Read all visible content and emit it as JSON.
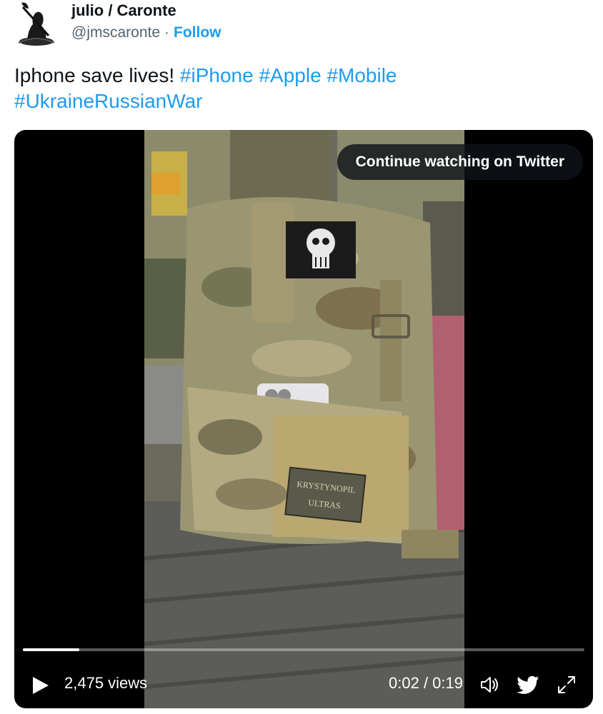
{
  "author": {
    "name": "julio / Caronte",
    "handle": "@jmscaronte",
    "separator": "·",
    "follow_label": "Follow",
    "avatar_icon": "caronte-avatar-icon"
  },
  "tweet": {
    "text": "Iphone save lives! ",
    "hashtags": [
      "#iPhone",
      "#Apple",
      "#Mobile",
      "#UkraineRussianWar"
    ]
  },
  "video": {
    "overlay_label": "Continue watching on Twitter",
    "views": "2,475 views",
    "time": "0:02 / 0:19",
    "progress": 0.1,
    "frame_patch_text": "KRYSTYNOPIL",
    "frame_patch_text_2": "ULTRAS",
    "icons": [
      "play-icon",
      "volume-icon",
      "twitter-bird-icon",
      "fullscreen-icon"
    ]
  },
  "colors": {
    "link": "#1d9bf0",
    "text": "#0f1419",
    "secondary": "#536471",
    "video_bg": "#000000"
  }
}
